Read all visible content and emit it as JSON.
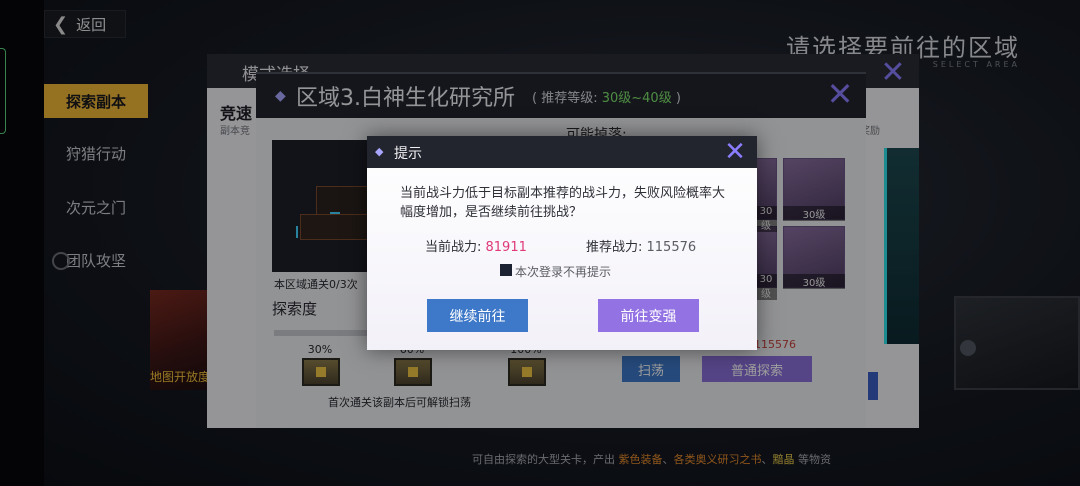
{
  "top": {
    "back_label": "返回",
    "heading": "请选择要前往的区域",
    "heading_en": "SELECT AREA"
  },
  "sidebar": {
    "items": [
      {
        "label": "探索副本",
        "active": true
      },
      {
        "label": "狩猎行动",
        "active": false
      },
      {
        "label": "次元之门",
        "active": false
      },
      {
        "label": "团队攻坚",
        "active": false
      }
    ],
    "banner_text": "地图开放度"
  },
  "mode_panel": {
    "title": "模式选择",
    "speed_label": "竞速",
    "speed_sub": "副本竞",
    "reward_label": "度奖励"
  },
  "region": {
    "title": "区域3.白神生化研究所",
    "level_prefix": "( 推荐等级: ",
    "level_value": "30级~40级",
    "level_suffix": " )",
    "clear_text": "本区域通关0/3次",
    "explore_label": "探索度",
    "progress": 0,
    "milestones": [
      "30%",
      "60%",
      "100%"
    ],
    "first_clear_note": "首次通关该副本后可解锁扫荡",
    "possible_drops_label": "可能掉落:",
    "drops": [
      {
        "level": "30级"
      },
      {
        "level": "30级"
      },
      {
        "level": "30级"
      },
      {
        "level": "30级"
      }
    ],
    "power_value": "115576",
    "sweep_label": "扫荡",
    "normal_explore_label": "普通探索"
  },
  "footer": {
    "prefix": "可自由探索的大型关卡，产出 ",
    "item1": "紫色装备",
    "sep1": "、",
    "item2": "各类奥义研习之书",
    "sep2": "、",
    "item3": "黯晶",
    "suffix": " 等物资"
  },
  "dialog": {
    "title": "提示",
    "message": "当前战斗力低于目标副本推荐的战斗力，失败风险概率大幅度增加，是否继续前往挑战？",
    "current_power_label": "当前战力: ",
    "current_power_value": "81911",
    "recommended_power_label": "推荐战力: ",
    "recommended_power_value": "115576",
    "no_remind_label": "本次登录不再提示",
    "no_remind_checked": false,
    "continue_label": "继续前往",
    "stronger_label": "前往变强"
  },
  "colors": {
    "accent_yellow": "#f1b737",
    "accent_purple": "#9372e4",
    "accent_blue": "#3e78c8",
    "power_low": "#e0397a",
    "level_green": "#7ee36b"
  }
}
